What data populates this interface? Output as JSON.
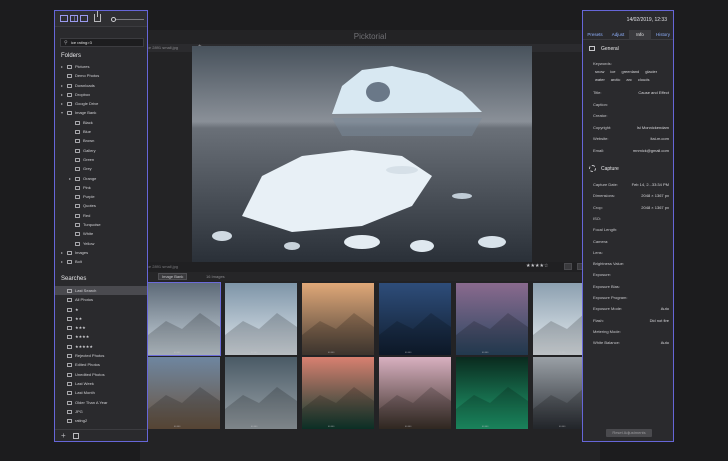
{
  "app": {
    "title": "Picktorial"
  },
  "tabs": [
    {
      "label": "ice 2891 small.jpg"
    }
  ],
  "left_panel": {
    "search": {
      "value": "ice rating>3",
      "placeholder": ""
    },
    "folders_heading": "Folders",
    "folders": [
      {
        "label": "Pictures",
        "arrow": "▸",
        "depth": 0
      },
      {
        "label": "Demo Photos",
        "arrow": "",
        "depth": 0
      },
      {
        "label": "Downloads",
        "arrow": "▸",
        "depth": 0
      },
      {
        "label": "Dropbox",
        "arrow": "▸",
        "depth": 0
      },
      {
        "label": "Google Drive",
        "arrow": "▸",
        "depth": 0
      },
      {
        "label": "Image Bank",
        "arrow": "▾",
        "depth": 0
      },
      {
        "label": "Black",
        "arrow": "",
        "depth": 1
      },
      {
        "label": "Blue",
        "arrow": "",
        "depth": 1
      },
      {
        "label": "Brown",
        "arrow": "",
        "depth": 1
      },
      {
        "label": "Gallery",
        "arrow": "",
        "depth": 1
      },
      {
        "label": "Green",
        "arrow": "",
        "depth": 1
      },
      {
        "label": "Grey",
        "arrow": "",
        "depth": 1
      },
      {
        "label": "Orange",
        "arrow": "▸",
        "depth": 1
      },
      {
        "label": "Pink",
        "arrow": "",
        "depth": 1
      },
      {
        "label": "Purple",
        "arrow": "",
        "depth": 1
      },
      {
        "label": "Quotes",
        "arrow": "",
        "depth": 1
      },
      {
        "label": "Red",
        "arrow": "",
        "depth": 1
      },
      {
        "label": "Turquoise",
        "arrow": "",
        "depth": 1
      },
      {
        "label": "White",
        "arrow": "",
        "depth": 1
      },
      {
        "label": "Yellow",
        "arrow": "",
        "depth": 1
      },
      {
        "label": "Images",
        "arrow": "▸",
        "depth": 0
      },
      {
        "label": "Bolt",
        "arrow": "▸",
        "depth": 0
      }
    ],
    "searches_heading": "Searches",
    "searches": [
      {
        "label": "Last Search",
        "active": true
      },
      {
        "label": "All Photos",
        "active": false
      },
      {
        "label": "★",
        "active": false
      },
      {
        "label": "★★",
        "active": false
      },
      {
        "label": "★★★",
        "active": false
      },
      {
        "label": "★★★★",
        "active": false
      },
      {
        "label": "★★★★★",
        "active": false
      },
      {
        "label": "Rejected Photos",
        "active": false
      },
      {
        "label": "Edited Photos",
        "active": false
      },
      {
        "label": "Unedited Photos",
        "active": false
      },
      {
        "label": "Last Week",
        "active": false
      },
      {
        "label": "Last Month",
        "active": false
      },
      {
        "label": "Older Than A Year",
        "active": false
      },
      {
        "label": "JPG",
        "active": false
      },
      {
        "label": "rating2",
        "active": false
      }
    ],
    "bottom": {
      "add": "+"
    }
  },
  "viewer": {
    "path": "ice 2891 small.jpg",
    "rating_stars": "★★★★☆",
    "sort_label": "Image Bank",
    "image_count": "16 Images"
  },
  "thumbnails": [
    {
      "name": "ice-floes",
      "top": "#5d6a78",
      "bottom": "#c9d4dc",
      "selected": true
    },
    {
      "name": "snow-dunes",
      "top": "#7e95a8",
      "bottom": "#dfe6ec",
      "selected": false
    },
    {
      "name": "hut-and-dog",
      "top": "#e0a878",
      "bottom": "#4a4038",
      "selected": false
    },
    {
      "name": "mountain-lake",
      "top": "#2e4d7a",
      "bottom": "#101e30",
      "selected": false
    },
    {
      "name": "pink-lake",
      "top": "#8a6a8e",
      "bottom": "#2a4660",
      "selected": false
    },
    {
      "name": "icy-shore",
      "top": "#8ca0b0",
      "bottom": "#e6ecf0",
      "selected": false
    },
    {
      "name": "hiker",
      "top": "#6e86a0",
      "bottom": "#6a5440",
      "selected": false
    },
    {
      "name": "ice-cave",
      "top": "#4a5a66",
      "bottom": "#9aa2a8",
      "selected": false
    },
    {
      "name": "green-aurora",
      "top": "#d88070",
      "bottom": "#0e3a2e",
      "selected": false
    },
    {
      "name": "rocky-coast",
      "top": "#d8b0c0",
      "bottom": "#3a3028",
      "selected": false
    },
    {
      "name": "aurora-sky",
      "top": "#0a2a1e",
      "bottom": "#20a070",
      "selected": false
    },
    {
      "name": "beach-waves",
      "top": "#9aa0a6",
      "bottom": "#2a2e34",
      "selected": false
    }
  ],
  "right_panel": {
    "date": "14/02/2019, 12:33",
    "tabs": [
      "Presets",
      "Adjust",
      "Info",
      "History"
    ],
    "active_tab": "Info",
    "general_heading": "General",
    "keywords_label": "Keywords:",
    "keywords": [
      "snow",
      "ice",
      "greenland",
      "glacier",
      "water",
      "arctic",
      "arc",
      "clouds"
    ],
    "general_fields": [
      {
        "key": "Title:",
        "value": "Cause and Effect"
      },
      {
        "key": "Caption:",
        "value": ""
      },
      {
        "key": "Creator:",
        "value": ""
      },
      {
        "key": "Copyright:",
        "value": "Isi Monnickendam"
      },
      {
        "key": "Website:",
        "value": "itai-m.com"
      },
      {
        "key": "Email:",
        "value": "mnmick@gmail.com"
      }
    ],
    "capture_heading": "Capture",
    "capture_fields": [
      {
        "key": "Capture Date:",
        "value": "Feb 14, 2...33:34 PM"
      },
      {
        "key": "Dimensions:",
        "value": "2048 × 1367 px"
      },
      {
        "key": "Crop:",
        "value": "2048 × 1367 px"
      },
      {
        "key": "ISO:",
        "value": ""
      },
      {
        "key": "Focal Length:",
        "value": ""
      },
      {
        "key": "Camera:",
        "value": ""
      },
      {
        "key": "Lens:",
        "value": ""
      },
      {
        "key": "Brightness Value:",
        "value": ""
      },
      {
        "key": "Exposure:",
        "value": ""
      },
      {
        "key": "Exposure Bias:",
        "value": ""
      },
      {
        "key": "Exposure Program:",
        "value": ""
      },
      {
        "key": "Exposure Mode:",
        "value": "Auto"
      },
      {
        "key": "Flash:",
        "value": "Did not fire"
      },
      {
        "key": "Metering Mode:",
        "value": ""
      },
      {
        "key": "White Balance:",
        "value": "Auto"
      }
    ],
    "reset_label": "Reset Adjustments"
  },
  "colors": {
    "accent": "#6666d8",
    "panel": "#2a2a2d",
    "link": "#8fb1ff"
  }
}
